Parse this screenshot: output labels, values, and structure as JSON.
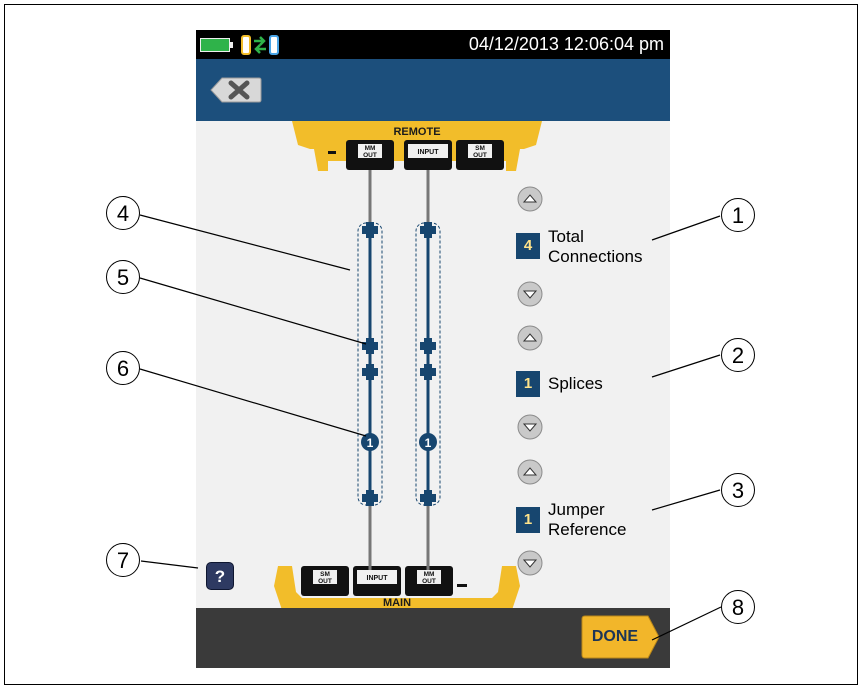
{
  "status_bar": {
    "datetime": "04/12/2013 12:06:04 pm",
    "battery_color": "#2fb34a"
  },
  "remote_unit": {
    "label": "REMOTE",
    "ports": [
      "MM\nOUT",
      "INPUT",
      "SM\nOUT"
    ]
  },
  "main_unit": {
    "label": "MAIN",
    "ports": [
      "SM\nOUT",
      "INPUT",
      "MM\nOUT"
    ]
  },
  "controls": {
    "total_connections": {
      "value": "4",
      "label_line1": "Total",
      "label_line2": "Connections"
    },
    "splices": {
      "value": "1",
      "label": "Splices"
    },
    "jumper_reference": {
      "value": "1",
      "label_line1": "Jumper",
      "label_line2": "Reference"
    }
  },
  "fiber": {
    "splice_marker_label": "1"
  },
  "help_label": "?",
  "done_label": "DONE",
  "callouts": [
    "1",
    "2",
    "3",
    "4",
    "5",
    "6",
    "7",
    "8"
  ],
  "colors": {
    "title_bar": "#1c4f7c",
    "fiber": "#17466f",
    "unit_yellow": "#f2bd2a",
    "done_button": "#f2b62a"
  }
}
